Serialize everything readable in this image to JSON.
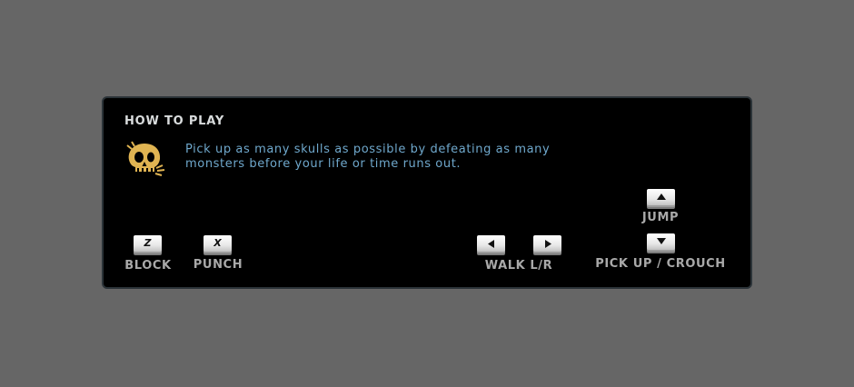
{
  "how_to_play": {
    "title": "HOW TO PLAY",
    "icon": "skull-icon",
    "description": "Pick up as many skulls as possible by defeating as many monsters before your life or time runs out."
  },
  "controls": {
    "block": {
      "key": "Z",
      "label": "BLOCK"
    },
    "punch": {
      "key": "X",
      "label": "PUNCH"
    },
    "walk": {
      "keys": [
        "left-arrow-icon",
        "right-arrow-icon"
      ],
      "label": "WALK L/R"
    },
    "jump": {
      "key": "up-arrow-icon",
      "label": "JUMP"
    },
    "crouch": {
      "key": "down-arrow-icon",
      "label": "PICK UP / CROUCH"
    }
  },
  "colors": {
    "background": "#666666",
    "panel": "#000000",
    "title": "#d9dcdd",
    "description": "#6fa8cc",
    "label": "#a9a9a9",
    "skull": "#e0b452"
  }
}
